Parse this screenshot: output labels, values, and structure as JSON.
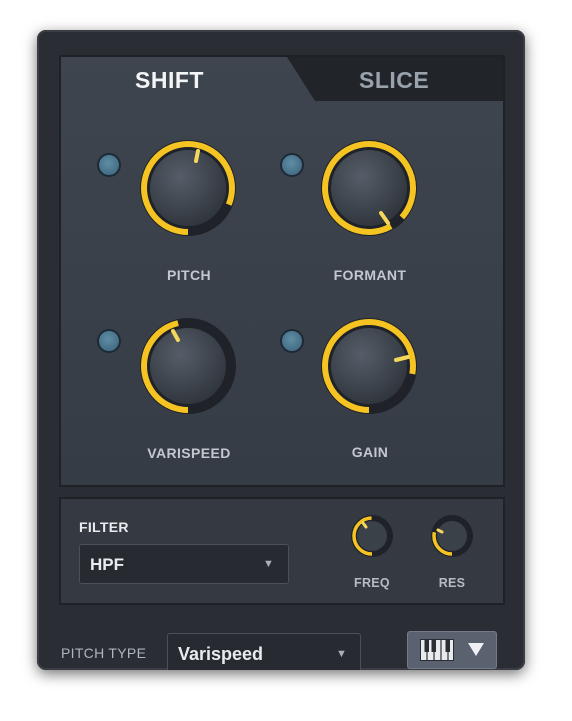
{
  "tabs": [
    {
      "label": "SHIFT",
      "active": true
    },
    {
      "label": "SLICE",
      "active": false
    }
  ],
  "knobs": {
    "pitch": {
      "label": "PITCH"
    },
    "formant": {
      "label": "FORMANT"
    },
    "varispeed": {
      "label": "VARISPEED"
    },
    "gain": {
      "label": "GAIN"
    }
  },
  "filter": {
    "title": "FILTER",
    "type_value": "HPF",
    "freq_label": "FREQ",
    "res_label": "RES"
  },
  "pitch_type": {
    "label": "PITCH TYPE",
    "value": "Varispeed"
  },
  "colors": {
    "accent": "#f5c423",
    "indicator": "#4c8098",
    "knob_body": "#3b4149"
  },
  "icons": {
    "dropdown_arrow": "▼",
    "keyboard": "piano-keyboard-icon"
  }
}
